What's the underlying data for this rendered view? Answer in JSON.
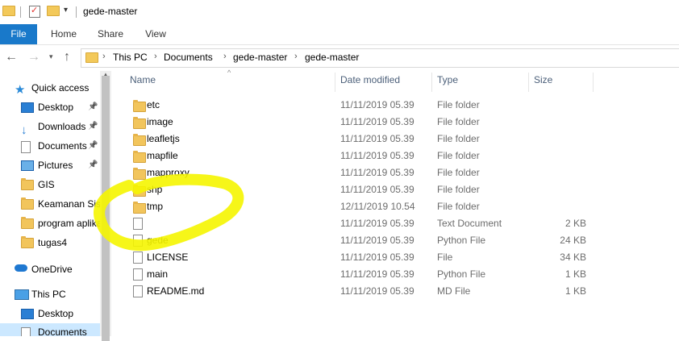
{
  "window": {
    "title": "gede-master"
  },
  "ribbon": {
    "tabs": [
      "File",
      "Home",
      "Share",
      "View"
    ]
  },
  "address": {
    "crumbs": [
      "This PC",
      "Documents",
      "gede-master",
      "gede-master"
    ]
  },
  "nav": {
    "items": [
      {
        "label": "Quick access",
        "icon": "star-icon",
        "pinned": false,
        "selected": false
      },
      {
        "label": "Desktop",
        "icon": "desktop-icon",
        "pinned": true,
        "selected": false
      },
      {
        "label": "Downloads",
        "icon": "download-icon",
        "pinned": true,
        "selected": false
      },
      {
        "label": "Documents",
        "icon": "document-icon",
        "pinned": true,
        "selected": false
      },
      {
        "label": "Pictures",
        "icon": "pictures-icon",
        "pinned": true,
        "selected": false
      },
      {
        "label": "GIS",
        "icon": "folder-icon",
        "pinned": false,
        "selected": false
      },
      {
        "label": "Keamanan Sist",
        "icon": "folder-icon",
        "pinned": false,
        "selected": false
      },
      {
        "label": "program aplika",
        "icon": "folder-icon",
        "pinned": false,
        "selected": false
      },
      {
        "label": "tugas4",
        "icon": "folder-icon",
        "pinned": false,
        "selected": false
      },
      {
        "label": "OneDrive",
        "icon": "onedrive-icon",
        "pinned": false,
        "selected": false
      },
      {
        "label": "This PC",
        "icon": "pc-icon",
        "pinned": false,
        "selected": false
      },
      {
        "label": "Desktop",
        "icon": "desktop-icon",
        "pinned": false,
        "selected": false
      },
      {
        "label": "Documents",
        "icon": "document-icon",
        "pinned": false,
        "selected": true
      }
    ]
  },
  "columns": {
    "name": "Name",
    "date": "Date modified",
    "type": "Type",
    "size": "Size"
  },
  "files": [
    {
      "name": "etc",
      "date": "11/11/2019 05.39",
      "type": "File folder",
      "size": "",
      "icon": "folder-icon"
    },
    {
      "name": "image",
      "date": "11/11/2019 05.39",
      "type": "File folder",
      "size": "",
      "icon": "folder-icon"
    },
    {
      "name": "leafletjs",
      "date": "11/11/2019 05.39",
      "type": "File folder",
      "size": "",
      "icon": "folder-icon"
    },
    {
      "name": "mapfile",
      "date": "11/11/2019 05.39",
      "type": "File folder",
      "size": "",
      "icon": "folder-icon"
    },
    {
      "name": "mapproxy",
      "date": "11/11/2019 05.39",
      "type": "File folder",
      "size": "",
      "icon": "folder-icon"
    },
    {
      "name": "shp",
      "date": "11/11/2019 05.39",
      "type": "File folder",
      "size": "",
      "icon": "folder-icon"
    },
    {
      "name": "tmp",
      "date": "12/11/2019 10.54",
      "type": "File folder",
      "size": "",
      "icon": "folder-icon"
    },
    {
      "name": "",
      "date": "11/11/2019 05.39",
      "type": "Text Document",
      "size": "2 KB",
      "icon": "file-icon"
    },
    {
      "name": "gede",
      "date": "11/11/2019 05.39",
      "type": "Python File",
      "size": "24 KB",
      "icon": "file-icon"
    },
    {
      "name": "LICENSE",
      "date": "11/11/2019 05.39",
      "type": "File",
      "size": "34 KB",
      "icon": "file-icon"
    },
    {
      "name": "main",
      "date": "11/11/2019 05.39",
      "type": "Python File",
      "size": "1 KB",
      "icon": "file-icon"
    },
    {
      "name": "README.md",
      "date": "11/11/2019 05.39",
      "type": "MD File",
      "size": "1 KB",
      "icon": "file-icon"
    }
  ],
  "colors": {
    "accent": "#1979ca",
    "folder": "#f2c55c",
    "selected": "#cce8ff",
    "highlight": "#f5f500"
  }
}
